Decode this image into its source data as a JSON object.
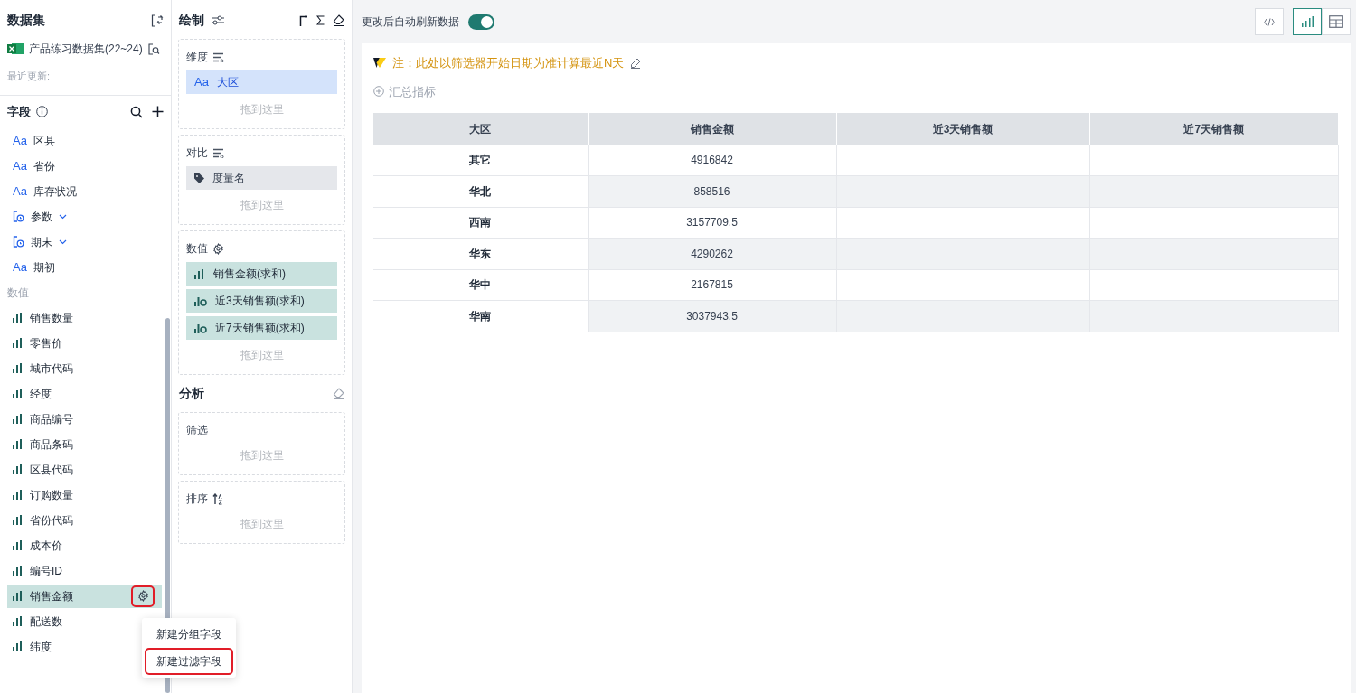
{
  "dataset": {
    "title": "数据集",
    "name": "产品练习数据集(22~24)",
    "updated": "最近更新:"
  },
  "fields": {
    "title": "字段",
    "items": [
      {
        "kind": "text",
        "type_mark": "Aa",
        "label": "区县",
        "selected": false
      },
      {
        "kind": "text",
        "type_mark": "Aa",
        "label": "省份",
        "selected": false
      },
      {
        "kind": "text",
        "type_mark": "Aa",
        "label": "库存状况",
        "selected": false
      },
      {
        "kind": "date",
        "label": "参数",
        "selected": false
      },
      {
        "kind": "date",
        "label": "期末",
        "selected": false
      },
      {
        "kind": "text",
        "type_mark": "Aa",
        "label": "期初",
        "selected": false
      },
      {
        "kind": "section",
        "label": "数值"
      },
      {
        "kind": "measure",
        "label": "销售数量",
        "selected": false
      },
      {
        "kind": "measure",
        "label": "零售价",
        "selected": false
      },
      {
        "kind": "measure",
        "label": "城市代码",
        "selected": false
      },
      {
        "kind": "measure",
        "label": "经度",
        "selected": false
      },
      {
        "kind": "measure",
        "label": "商品编号",
        "selected": false
      },
      {
        "kind": "measure",
        "label": "商品条码",
        "selected": false
      },
      {
        "kind": "measure",
        "label": "区县代码",
        "selected": false
      },
      {
        "kind": "measure",
        "label": "订购数量",
        "selected": false
      },
      {
        "kind": "measure",
        "label": "省份代码",
        "selected": false
      },
      {
        "kind": "measure",
        "label": "成本价",
        "selected": false
      },
      {
        "kind": "measure",
        "label": "编号ID",
        "selected": false
      },
      {
        "kind": "measure",
        "label": "销售金额",
        "selected": true
      },
      {
        "kind": "measure",
        "label": "配送数",
        "selected": false
      },
      {
        "kind": "measure",
        "label": "纬度",
        "selected": false
      }
    ]
  },
  "context_menu": [
    {
      "label": "新建分组字段",
      "highlighted": false
    },
    {
      "label": "新建过滤字段",
      "highlighted": true
    }
  ],
  "draw": {
    "title": "绘制",
    "sections": [
      {
        "title": "维度",
        "kind": "sort",
        "chips": [
          {
            "kind": "dimension",
            "type_mark": "Aa",
            "label": "大区"
          }
        ],
        "drop_hint": "拖到这里"
      },
      {
        "title": "对比",
        "kind": "sort",
        "chips": [
          {
            "kind": "tag",
            "label": "度量名"
          }
        ],
        "drop_hint": "拖到这里"
      },
      {
        "title": "数值",
        "kind": "gear",
        "chips": [
          {
            "kind": "measure",
            "label": "销售金额(求和)"
          },
          {
            "kind": "calc",
            "label": "近3天销售额(求和)"
          },
          {
            "kind": "calc",
            "label": "近7天销售额(求和)"
          }
        ],
        "drop_hint": "拖到这里"
      }
    ]
  },
  "analysis": {
    "title": "分析",
    "sections": [
      {
        "title": "筛选",
        "kind": "plain",
        "drop_hint": "拖到这里"
      },
      {
        "title": "排序",
        "kind": "az",
        "drop_hint": "拖到这里"
      }
    ]
  },
  "toolbar": {
    "auto_refresh_label": "更改后自动刷新数据",
    "auto_refresh_on": true,
    "views": [
      {
        "kind": "code",
        "selected": false
      },
      {
        "kind": "chart",
        "selected": true
      },
      {
        "kind": "table",
        "selected": false
      }
    ]
  },
  "note": "注：此处以筛选器开始日期为准计算最近N天",
  "summary_link": "汇总指标",
  "table": {
    "columns": [
      "大区",
      "销售金额",
      "近3天销售额",
      "近7天销售额"
    ],
    "rows": [
      [
        "其它",
        "4916842",
        "",
        ""
      ],
      [
        "华北",
        "858516",
        "",
        ""
      ],
      [
        "西南",
        "3157709.5",
        "",
        ""
      ],
      [
        "华东",
        "4290262",
        "",
        ""
      ],
      [
        "华中",
        "2167815",
        "",
        ""
      ],
      [
        "华南",
        "3037943.5",
        "",
        ""
      ]
    ]
  }
}
